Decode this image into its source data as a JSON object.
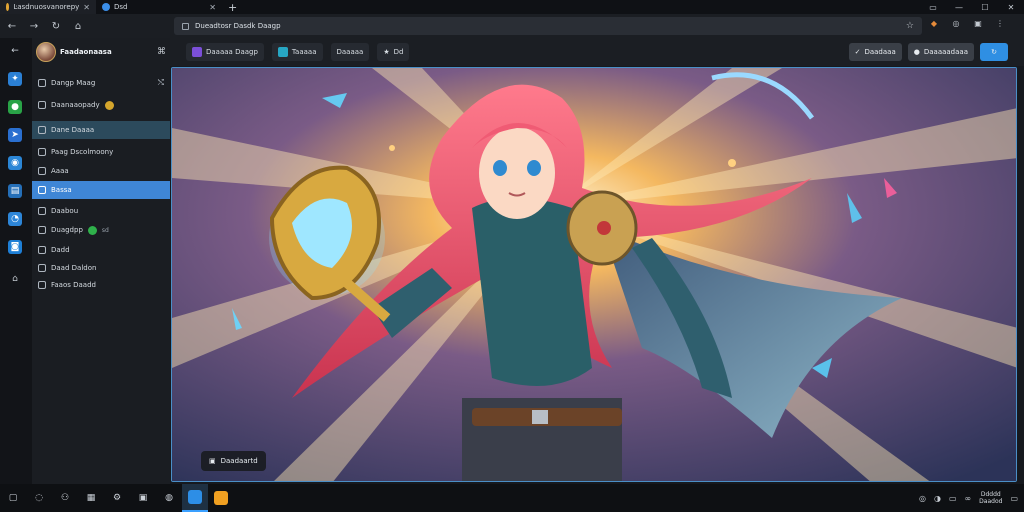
{
  "browser": {
    "tabs": [
      {
        "label": "Ŀasdnuosvanorepy",
        "active": true
      },
      {
        "label": "Dsd",
        "active": false
      }
    ],
    "address": {
      "url": "Dueadtosr Dasdk Daagp"
    },
    "window_controls": [
      "minimize",
      "maximize",
      "close"
    ]
  },
  "sidebar": {
    "profile_name": "Faadaonaasa",
    "items": [
      {
        "label": "Dangp Maag",
        "state": "normal"
      },
      {
        "label": "Daanaaopady",
        "state": "normal"
      },
      {
        "label": "Dane Daaaa",
        "state": "hover"
      },
      {
        "label": "Paag Dscolmoony",
        "state": "normal"
      },
      {
        "label": "Aaaa",
        "state": "normal"
      },
      {
        "label": "Bassa",
        "state": "active"
      },
      {
        "label": "Daabou",
        "state": "normal"
      },
      {
        "label": "Duagdpp",
        "state": "normal",
        "suffix": "sd"
      },
      {
        "label": "Dadd",
        "state": "normal"
      },
      {
        "label": "Daad Daldon",
        "state": "normal"
      },
      {
        "label": "Faaos Daadd",
        "state": "normal"
      }
    ]
  },
  "toolbar": {
    "chips": [
      {
        "label": "Daaaaa Daagp",
        "color": "#7b4fd8"
      },
      {
        "label": "Taaaaa",
        "color": "#27a7c4"
      },
      {
        "label": "Daaaaa",
        "color": ""
      },
      {
        "label": "Dd",
        "color": ""
      }
    ],
    "right_buttons": [
      {
        "label": "Daadaaa"
      },
      {
        "label": "Daaaaadaaa"
      }
    ]
  },
  "artwork": {
    "caption": "Daadaartd",
    "colors": {
      "hair": "#e94a6f",
      "outfit": "#2a5f68",
      "cape": "#3f5a7a",
      "armor": "#c9a152",
      "background": "#3a4368"
    }
  },
  "taskbar": {
    "clock_line1": "Ddddd",
    "clock_line2": "Daadod"
  }
}
